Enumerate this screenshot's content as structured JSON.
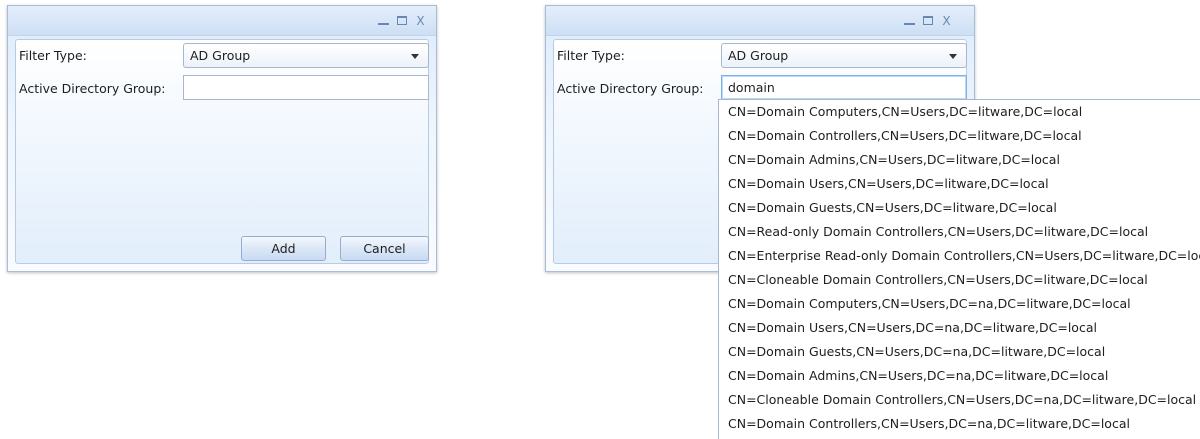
{
  "left_dialog": {
    "title_buttons": {
      "minimize": "—",
      "maximize": "□",
      "close": "X"
    },
    "filter_type_label": "Filter Type:",
    "filter_type_value": "AD Group",
    "ad_group_label": "Active Directory Group:",
    "ad_group_value": "",
    "add_label": "Add",
    "cancel_label": "Cancel"
  },
  "right_dialog": {
    "title_buttons": {
      "minimize": "—",
      "maximize": "□",
      "close": "X"
    },
    "filter_type_label": "Filter Type:",
    "filter_type_value": "AD Group",
    "ad_group_label": "Active Directory Group:",
    "ad_group_value": "domain"
  },
  "suggestions": [
    "CN=Domain Computers,CN=Users,DC=litware,DC=local",
    "CN=Domain Controllers,CN=Users,DC=litware,DC=local",
    "CN=Domain Admins,CN=Users,DC=litware,DC=local",
    "CN=Domain Users,CN=Users,DC=litware,DC=local",
    "CN=Domain Guests,CN=Users,DC=litware,DC=local",
    "CN=Read-only Domain Controllers,CN=Users,DC=litware,DC=local",
    "CN=Enterprise Read-only Domain Controllers,CN=Users,DC=litware,DC=local",
    "CN=Cloneable Domain Controllers,CN=Users,DC=litware,DC=local",
    "CN=Domain Computers,CN=Users,DC=na,DC=litware,DC=local",
    "CN=Domain Users,CN=Users,DC=na,DC=litware,DC=local",
    "CN=Domain Guests,CN=Users,DC=na,DC=litware,DC=local",
    "CN=Domain Admins,CN=Users,DC=na,DC=litware,DC=local",
    "CN=Cloneable Domain Controllers,CN=Users,DC=na,DC=litware,DC=local",
    "CN=Domain Controllers,CN=Users,DC=na,DC=litware,DC=local"
  ]
}
